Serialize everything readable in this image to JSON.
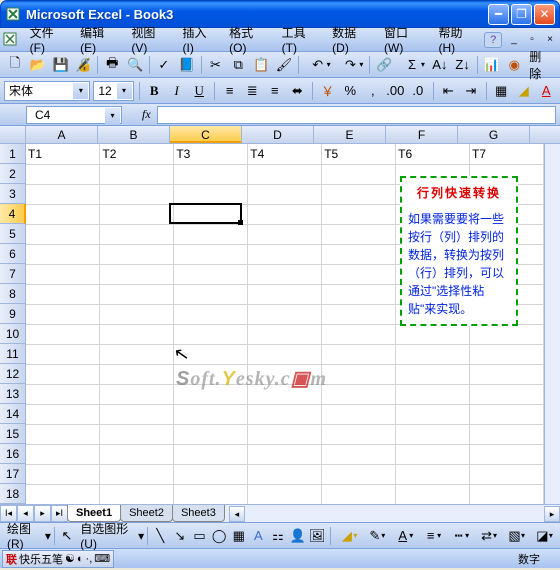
{
  "title": "Microsoft Excel - Book3",
  "menus": {
    "file": "文件(F)",
    "edit": "编辑(E)",
    "view": "视图(V)",
    "insert": "插入(I)",
    "format": "格式(O)",
    "tools": "工具(T)",
    "data": "数据(D)",
    "window": "窗口(W)",
    "help": "帮助(H)"
  },
  "toolbar": {
    "delete_label": "删除"
  },
  "font": {
    "name": "宋体",
    "size": "12"
  },
  "namebox": {
    "ref": "C4",
    "fx": "fx"
  },
  "columns": [
    "A",
    "B",
    "C",
    "D",
    "E",
    "F",
    "G"
  ],
  "rows": [
    "1",
    "2",
    "3",
    "4",
    "5",
    "6",
    "7",
    "8",
    "9",
    "10",
    "11",
    "12",
    "13",
    "14",
    "15",
    "16",
    "17",
    "18"
  ],
  "row1": [
    "T1",
    "T2",
    "T3",
    "T4",
    "T5",
    "T6",
    "T7"
  ],
  "info": {
    "title": "行列快速转换",
    "body": "如果需要要将一些按行（列）排列的数据，转换为按列（行）排列，可以通过\"选择性粘贴\"来实现。"
  },
  "watermark": "Soft.Yesky.com",
  "sheets": [
    "Sheet1",
    "Sheet2",
    "Sheet3"
  ],
  "draw": {
    "label": "绘图(R)",
    "autoshape": "自选图形(U)"
  },
  "status": {
    "ime": "快乐五笔",
    "num": "数字"
  },
  "active": {
    "col": "C",
    "row": "4"
  }
}
